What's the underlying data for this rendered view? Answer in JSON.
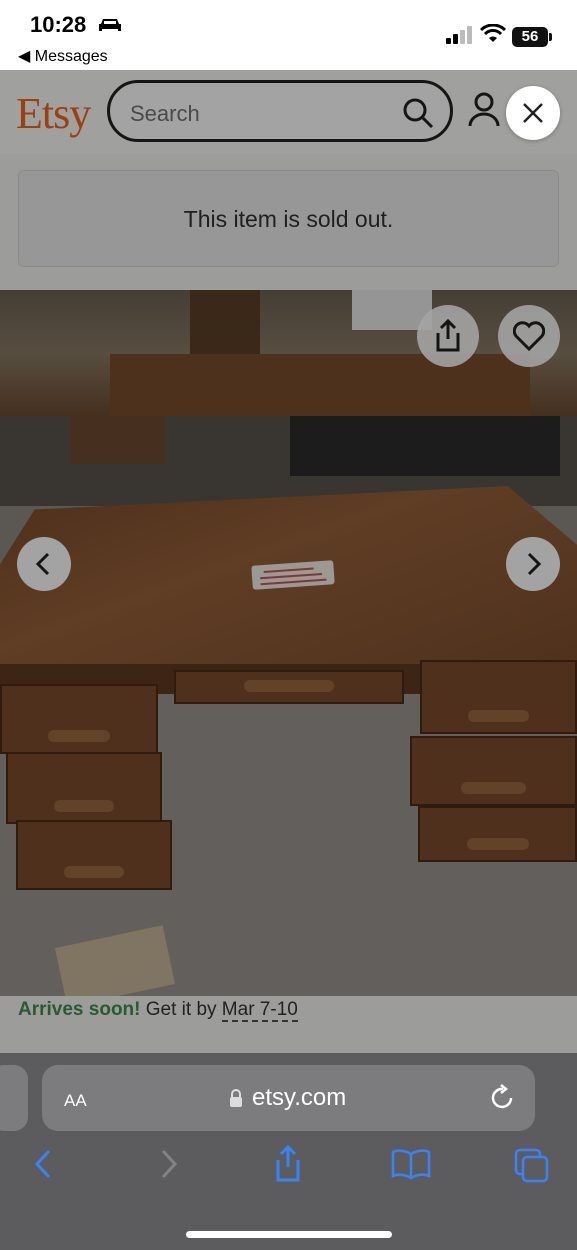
{
  "status_bar": {
    "time": "10:28",
    "back_app": "◀ Messages",
    "battery": "56"
  },
  "header": {
    "logo": "Etsy",
    "search_placeholder": "Search"
  },
  "listing": {
    "sold_message": "This item is sold out.",
    "arrives_label": "Arrives soon!",
    "arrives_text": " Get it by ",
    "arrives_date": "Mar 7-10"
  },
  "browser": {
    "aa_label": "AA",
    "url": "etsy.com"
  },
  "colors": {
    "etsy_orange": "#f1641e",
    "arrives_green": "#2a5a2e",
    "safari_bar": "#5c5c5e",
    "ios_blue": "#3a82f7"
  },
  "icons": {
    "car": "car-icon",
    "signal": "cellular-signal-icon",
    "wifi": "wifi-icon",
    "search": "search-icon",
    "user": "user-icon",
    "close": "close-icon",
    "share": "share-icon",
    "favorite": "heart-icon",
    "prev": "chevron-left-icon",
    "next": "chevron-right-icon",
    "lock": "lock-icon",
    "reload": "reload-icon",
    "back": "back-icon",
    "forward": "forward-icon",
    "safari_share": "share-icon",
    "bookmarks": "bookmarks-icon",
    "tabs": "tabs-icon"
  }
}
